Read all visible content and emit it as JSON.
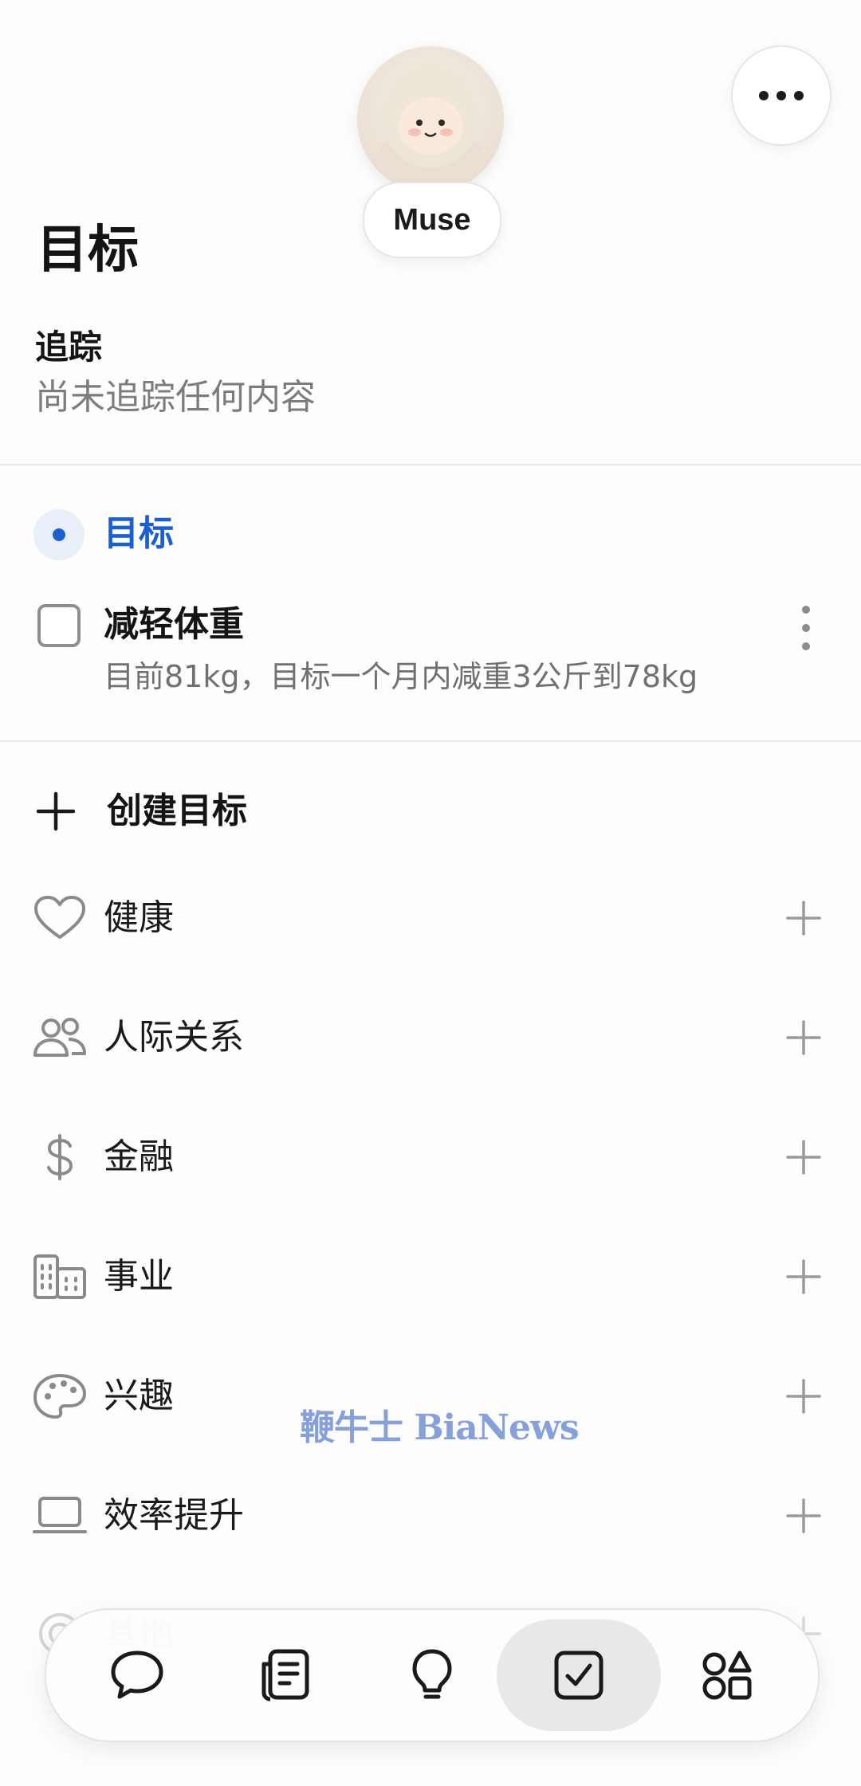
{
  "header": {
    "assistant_name": "Muse",
    "more_icon": "more-horizontal-icon"
  },
  "page": {
    "title": "目标"
  },
  "tracking": {
    "title": "追踪",
    "empty_text": "尚未追踪任何内容"
  },
  "goals_section": {
    "label": "目标",
    "accent_color": "#1c5fd1",
    "items": [
      {
        "title": "减轻体重",
        "description": "目前81kg，目标一个月内减重3公斤到78kg",
        "checked": false
      }
    ]
  },
  "create": {
    "label": "创建目标"
  },
  "categories": [
    {
      "label": "健康",
      "icon": "heart-icon"
    },
    {
      "label": "人际关系",
      "icon": "people-icon"
    },
    {
      "label": "金融",
      "icon": "dollar-icon"
    },
    {
      "label": "事业",
      "icon": "buildings-icon"
    },
    {
      "label": "兴趣",
      "icon": "palette-icon"
    },
    {
      "label": "效率提升",
      "icon": "laptop-icon"
    },
    {
      "label": "其他",
      "icon": "target-icon"
    }
  ],
  "watermark": "鞭牛士 BiaNews",
  "bottom_nav": {
    "items": [
      {
        "icon": "chat-icon"
      },
      {
        "icon": "journal-icon"
      },
      {
        "icon": "lightbulb-icon"
      },
      {
        "icon": "checkbox-icon",
        "active": true
      },
      {
        "icon": "shapes-icon"
      }
    ]
  }
}
